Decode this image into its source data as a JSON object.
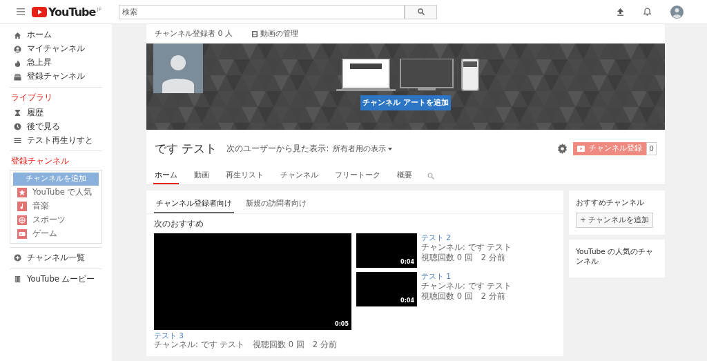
{
  "header": {
    "logo_text": "YouTube",
    "region": "JP",
    "search": {
      "placeholder": "検索"
    }
  },
  "sidebar": {
    "main": [
      {
        "label": "ホーム",
        "kind": "home"
      },
      {
        "label": "マイチャンネル",
        "kind": "account"
      },
      {
        "label": "急上昇",
        "kind": "trending"
      },
      {
        "label": "登録チャンネル",
        "kind": "subscriptions"
      }
    ],
    "library": {
      "heading": "ライブラリ",
      "items": [
        {
          "label": "履歴",
          "kind": "history"
        },
        {
          "label": "後で見る",
          "kind": "later"
        },
        {
          "label": "テスト再生りすと",
          "kind": "playlist"
        }
      ]
    },
    "subscriptions": {
      "heading": "登録チャンネル",
      "add_button": "チャンネルを追加",
      "items": [
        {
          "label": "YouTube で人気",
          "kind": "popular"
        },
        {
          "label": "音楽",
          "kind": "music"
        },
        {
          "label": "スポーツ",
          "kind": "sports"
        },
        {
          "label": "ゲーム",
          "kind": "gaming"
        }
      ]
    },
    "footer": [
      {
        "label": "チャンネル一覧",
        "kind": "browse"
      },
      {
        "label": "YouTube ムービー",
        "kind": "movies"
      }
    ]
  },
  "channel": {
    "subscriber_count": "チャンネル登録者 0 人",
    "manage_link": "動画の管理",
    "add_art_button": "チャンネル アートを追加",
    "name": "です テスト",
    "view_as_label": "次のユーザーから見た表示:",
    "view_as_value": "所有者用の表示",
    "subscribe_button": "チャンネル登録",
    "subscribe_count": "0",
    "tabs": [
      {
        "label": "ホーム",
        "selected": true
      },
      {
        "label": "動画",
        "selected": false
      },
      {
        "label": "再生リスト",
        "selected": false
      },
      {
        "label": "チャンネル",
        "selected": false
      },
      {
        "label": "フリートーク",
        "selected": false
      },
      {
        "label": "概要",
        "selected": false
      }
    ]
  },
  "feed": {
    "tabs": [
      {
        "label": "チャンネル登録者向け",
        "selected": true
      },
      {
        "label": "新規の訪問者向け",
        "selected": false
      }
    ],
    "section_title": "次のおすすめ",
    "featured": {
      "duration": "0:05",
      "title": "テスト 3",
      "meta": "チャンネル: です テスト　視聴回数 0 回　2 分前"
    },
    "videos": [
      {
        "title": "テスト 2",
        "duration": "0:04",
        "channel": "チャンネル: です テスト",
        "meta": "視聴回数 0 回　2 分前"
      },
      {
        "title": "テスト 1",
        "duration": "0:04",
        "channel": "チャンネル: です テスト",
        "meta": "視聴回数 0 回　2 分前"
      }
    ]
  },
  "right": {
    "recommended": {
      "title": "おすすめチャンネル",
      "button": "+ チャンネルを追加"
    },
    "popular": {
      "title": "YouTube の人気のチャンネル"
    }
  }
}
